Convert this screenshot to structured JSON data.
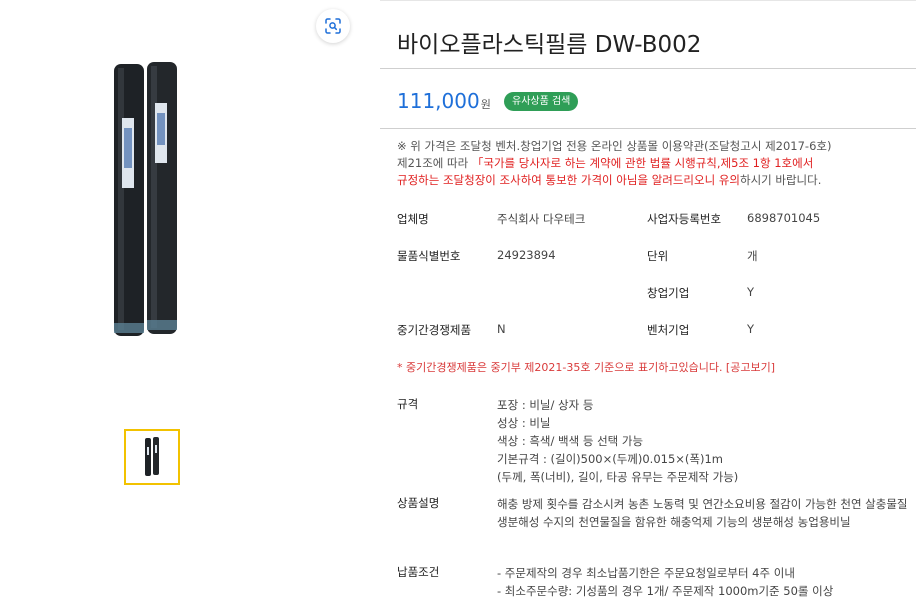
{
  "product": {
    "title": "바이오플라스틱필름 DW-B002",
    "price": "111,000",
    "price_unit": "원",
    "similar_search_label": "유사상품 검색"
  },
  "notice": {
    "line1": "※ 위 가격은 조달청 벤처.창업기업 전용 온라인 상품몰 이용약관(조달청고시 제2017-6호)",
    "line2_prefix": "제21조에 따라 ",
    "line2_red": "「국가를 당사자로 하는 계약에 관한 법률 시행규칙,제5조 1항 1호에서",
    "line3_red": "규정하는 조달청장이 조사하여 통보한 가격이 아님을 알려드리오니 유의",
    "line3_suffix": "하시기 바랍니다."
  },
  "info": {
    "company_label": "업체명",
    "company_value": "주식회사 다우테크",
    "bizno_label": "사업자등록번호",
    "bizno_value": "6898701045",
    "itemid_label": "물품식별번호",
    "itemid_value": "24923894",
    "unit_label": "단위",
    "unit_value": "개",
    "startup_label": "창업기업",
    "startup_value": "Y",
    "sme_label": "중기간경쟁제품",
    "sme_value": "N",
    "venture_label": "벤처기업",
    "venture_value": "Y"
  },
  "footnote": "* 중기간경쟁제품은 중기부 제2021-35호 기준으로 표기하고있습니다. [공고보기]",
  "spec": {
    "label": "규격",
    "lines": [
      "포장 : 비닐/ 상자 등",
      "성상 : 비닐",
      "색상 : 흑색/ 백색 등 선택 가능",
      "기본규격 : (길이)500×(두께)0.015×(폭)1m",
      "(두께, 폭(너비), 길이, 타공 유무는 주문제작 가능)"
    ]
  },
  "description": {
    "label": "상품설명",
    "text": "해충 방제 횟수를 감소시켜 농촌 노동력 및 연간소요비용 절감이 가능한 천연 살충물질 생분해성 수지의 천연물질을 함유한 해충억제 기능의 생분해성 농업용비닐"
  },
  "delivery": {
    "label": "납품조건",
    "lines": [
      "- 주문제작의 경우 최소납품기한은 주문요청일로부터 4주 이내",
      "- 최소주문수량: 기성품의 경우 1개/ 주문제작 1000m기준 50롤 이상"
    ]
  },
  "icons": {
    "zoom": "zoom-scan-icon"
  },
  "colors": {
    "price": "#1e6fd9",
    "badge": "#2f9e57",
    "notice_red": "#e02020",
    "thumb_border": "#f2c200"
  }
}
